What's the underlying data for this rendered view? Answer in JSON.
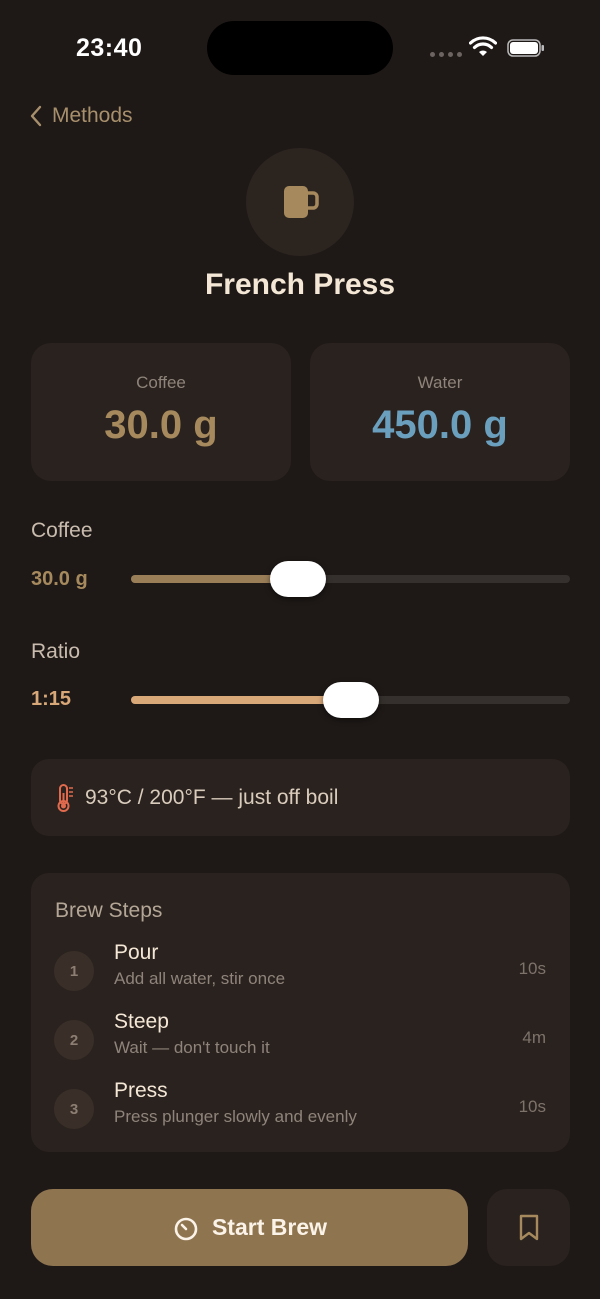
{
  "status_bar": {
    "time": "23:40"
  },
  "nav": {
    "back_label": "Methods"
  },
  "header": {
    "icon": "mug-icon",
    "title": "French Press"
  },
  "amounts": {
    "coffee": {
      "label": "Coffee",
      "value": "30.0 g"
    },
    "water": {
      "label": "Water",
      "value": "450.0 g"
    }
  },
  "sliders": {
    "coffee": {
      "label": "Coffee",
      "value": "30.0 g",
      "fraction": 0.38
    },
    "ratio": {
      "label": "Ratio",
      "value": "1:15",
      "fraction": 0.5
    }
  },
  "temperature": {
    "icon": "thermometer-icon",
    "text": "93°C / 200°F — just off boil"
  },
  "brew_steps": {
    "title": "Brew Steps",
    "steps": [
      {
        "num": "1",
        "name": "Pour",
        "desc": "Add all water, stir once",
        "duration": "10s"
      },
      {
        "num": "2",
        "name": "Steep",
        "desc": "Wait — don't touch it",
        "duration": "4m"
      },
      {
        "num": "3",
        "name": "Press",
        "desc": "Press plunger slowly and evenly",
        "duration": "10s"
      }
    ]
  },
  "actions": {
    "start_label": "Start Brew",
    "start_icon": "timer-icon",
    "bookmark_icon": "bookmark-icon"
  },
  "colors": {
    "background": "#1e1917",
    "accent": "#a68a5d",
    "water": "#6a9fbd",
    "ratio_fill": "#d9a878",
    "coffee_fill": "#9a7e58"
  }
}
